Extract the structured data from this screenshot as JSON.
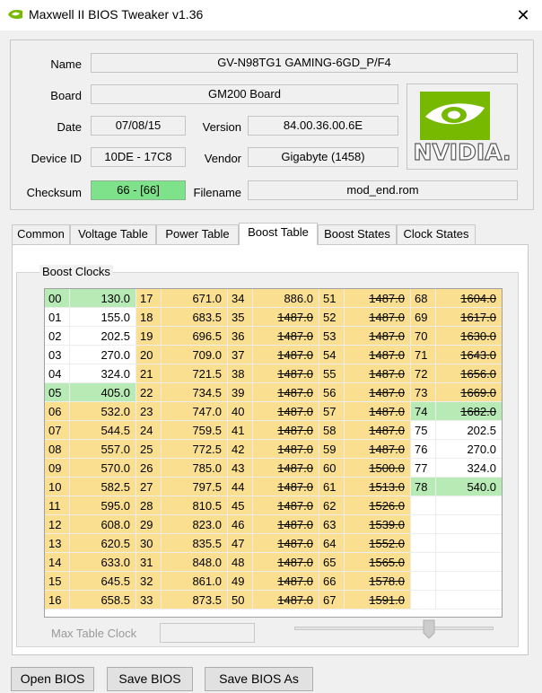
{
  "window": {
    "title": "Maxwell II BIOS Tweaker v1.36",
    "close_glyph": "✕"
  },
  "info": {
    "name_label": "Name",
    "name_value": "GV-N98TG1 GAMING-6GD_P/F4",
    "board_label": "Board",
    "board_value": "GM200 Board",
    "date_label": "Date",
    "date_value": "07/08/15",
    "version_label": "Version",
    "version_value": "84.00.36.00.6E",
    "device_label": "Device ID",
    "device_value": "10DE - 17C8",
    "vendor_label": "Vendor",
    "vendor_value": "Gigabyte (1458)",
    "checksum_label": "Checksum",
    "checksum_value": "66 - [66]",
    "filename_label": "Filename",
    "filename_value": "mod_end.rom",
    "logo_text": "NVIDIA."
  },
  "tabs": [
    {
      "label": "Common"
    },
    {
      "label": "Voltage Table"
    },
    {
      "label": "Power Table"
    },
    {
      "label": "Boost Table",
      "active": true
    },
    {
      "label": "Boost States"
    },
    {
      "label": "Clock States"
    }
  ],
  "boost": {
    "group_label": "Boost Clocks",
    "max_table_clock_label": "Max Table Clock",
    "max_table_clock_value": "",
    "entries": [
      {
        "i": "00",
        "v": "130.0",
        "s": "g"
      },
      {
        "i": "01",
        "v": "155.0",
        "s": "w"
      },
      {
        "i": "02",
        "v": "202.5",
        "s": "w"
      },
      {
        "i": "03",
        "v": "270.0",
        "s": "w"
      },
      {
        "i": "04",
        "v": "324.0",
        "s": "w"
      },
      {
        "i": "05",
        "v": "405.0",
        "s": "g"
      },
      {
        "i": "06",
        "v": "532.0",
        "s": "y"
      },
      {
        "i": "07",
        "v": "544.5",
        "s": "y"
      },
      {
        "i": "08",
        "v": "557.0",
        "s": "y"
      },
      {
        "i": "09",
        "v": "570.0",
        "s": "y"
      },
      {
        "i": "10",
        "v": "582.5",
        "s": "y"
      },
      {
        "i": "11",
        "v": "595.0",
        "s": "y"
      },
      {
        "i": "12",
        "v": "608.0",
        "s": "y"
      },
      {
        "i": "13",
        "v": "620.5",
        "s": "y"
      },
      {
        "i": "14",
        "v": "633.0",
        "s": "y"
      },
      {
        "i": "15",
        "v": "645.5",
        "s": "y"
      },
      {
        "i": "16",
        "v": "658.5",
        "s": "y"
      },
      {
        "i": "17",
        "v": "671.0",
        "s": "y"
      },
      {
        "i": "18",
        "v": "683.5",
        "s": "y"
      },
      {
        "i": "19",
        "v": "696.5",
        "s": "y"
      },
      {
        "i": "20",
        "v": "709.0",
        "s": "y"
      },
      {
        "i": "21",
        "v": "721.5",
        "s": "y"
      },
      {
        "i": "22",
        "v": "734.5",
        "s": "y"
      },
      {
        "i": "23",
        "v": "747.0",
        "s": "y"
      },
      {
        "i": "24",
        "v": "759.5",
        "s": "y"
      },
      {
        "i": "25",
        "v": "772.5",
        "s": "y"
      },
      {
        "i": "26",
        "v": "785.0",
        "s": "y"
      },
      {
        "i": "27",
        "v": "797.5",
        "s": "y"
      },
      {
        "i": "28",
        "v": "810.5",
        "s": "y"
      },
      {
        "i": "29",
        "v": "823.0",
        "s": "y"
      },
      {
        "i": "30",
        "v": "835.5",
        "s": "y"
      },
      {
        "i": "31",
        "v": "848.0",
        "s": "y"
      },
      {
        "i": "32",
        "v": "861.0",
        "s": "y"
      },
      {
        "i": "33",
        "v": "873.5",
        "s": "y"
      },
      {
        "i": "34",
        "v": "886.0",
        "s": "y"
      },
      {
        "i": "35",
        "v": "1487.0",
        "s": "y",
        "x": 1
      },
      {
        "i": "36",
        "v": "1487.0",
        "s": "y",
        "x": 1
      },
      {
        "i": "37",
        "v": "1487.0",
        "s": "y",
        "x": 1
      },
      {
        "i": "38",
        "v": "1487.0",
        "s": "y",
        "x": 1
      },
      {
        "i": "39",
        "v": "1487.0",
        "s": "y",
        "x": 1
      },
      {
        "i": "40",
        "v": "1487.0",
        "s": "y",
        "x": 1
      },
      {
        "i": "41",
        "v": "1487.0",
        "s": "y",
        "x": 1
      },
      {
        "i": "42",
        "v": "1487.0",
        "s": "y",
        "x": 1
      },
      {
        "i": "43",
        "v": "1487.0",
        "s": "y",
        "x": 1
      },
      {
        "i": "44",
        "v": "1487.0",
        "s": "y",
        "x": 1
      },
      {
        "i": "45",
        "v": "1487.0",
        "s": "y",
        "x": 1
      },
      {
        "i": "46",
        "v": "1487.0",
        "s": "y",
        "x": 1
      },
      {
        "i": "47",
        "v": "1487.0",
        "s": "y",
        "x": 1
      },
      {
        "i": "48",
        "v": "1487.0",
        "s": "y",
        "x": 1
      },
      {
        "i": "49",
        "v": "1487.0",
        "s": "y",
        "x": 1
      },
      {
        "i": "50",
        "v": "1487.0",
        "s": "y",
        "x": 1
      },
      {
        "i": "51",
        "v": "1487.0",
        "s": "y",
        "x": 1
      },
      {
        "i": "52",
        "v": "1487.0",
        "s": "y",
        "x": 1
      },
      {
        "i": "53",
        "v": "1487.0",
        "s": "y",
        "x": 1
      },
      {
        "i": "54",
        "v": "1487.0",
        "s": "y",
        "x": 1
      },
      {
        "i": "55",
        "v": "1487.0",
        "s": "y",
        "x": 1
      },
      {
        "i": "56",
        "v": "1487.0",
        "s": "y",
        "x": 1
      },
      {
        "i": "57",
        "v": "1487.0",
        "s": "y",
        "x": 1
      },
      {
        "i": "58",
        "v": "1487.0",
        "s": "y",
        "x": 1
      },
      {
        "i": "59",
        "v": "1487.0",
        "s": "y",
        "x": 1
      },
      {
        "i": "60",
        "v": "1500.0",
        "s": "y",
        "x": 1
      },
      {
        "i": "61",
        "v": "1513.0",
        "s": "y",
        "x": 1
      },
      {
        "i": "62",
        "v": "1526.0",
        "s": "y",
        "x": 1
      },
      {
        "i": "63",
        "v": "1539.0",
        "s": "y",
        "x": 1
      },
      {
        "i": "64",
        "v": "1552.0",
        "s": "y",
        "x": 1
      },
      {
        "i": "65",
        "v": "1565.0",
        "s": "y",
        "x": 1
      },
      {
        "i": "66",
        "v": "1578.0",
        "s": "y",
        "x": 1
      },
      {
        "i": "67",
        "v": "1591.0",
        "s": "y",
        "x": 1
      },
      {
        "i": "68",
        "v": "1604.0",
        "s": "y",
        "x": 1
      },
      {
        "i": "69",
        "v": "1617.0",
        "s": "y",
        "x": 1
      },
      {
        "i": "70",
        "v": "1630.0",
        "s": "y",
        "x": 1
      },
      {
        "i": "71",
        "v": "1643.0",
        "s": "y",
        "x": 1
      },
      {
        "i": "72",
        "v": "1656.0",
        "s": "y",
        "x": 1
      },
      {
        "i": "73",
        "v": "1669.0",
        "s": "y",
        "x": 1
      },
      {
        "i": "74",
        "v": "1682.0",
        "s": "g",
        "x": 1
      },
      {
        "i": "75",
        "v": "202.5",
        "s": "w"
      },
      {
        "i": "76",
        "v": "270.0",
        "s": "w"
      },
      {
        "i": "77",
        "v": "324.0",
        "s": "w"
      },
      {
        "i": "78",
        "v": "540.0",
        "s": "g"
      }
    ]
  },
  "buttons": {
    "open": "Open BIOS",
    "save": "Save BIOS",
    "save_as": "Save BIOS As"
  },
  "colors": {
    "yellow": "#fbdf91",
    "green": "#b8eab6",
    "nvidia_green": "#76b900"
  }
}
